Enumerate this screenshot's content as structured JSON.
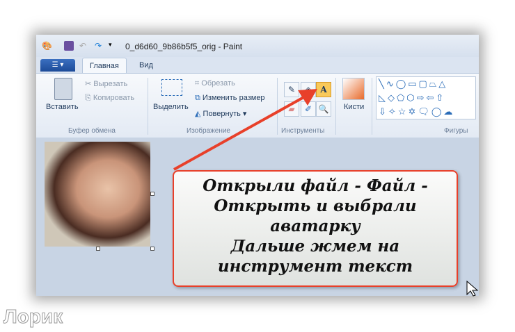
{
  "window": {
    "title": "0_d6d60_9b86b5f5_orig - Paint"
  },
  "tabs": [
    {
      "label": "Главная",
      "active": true
    },
    {
      "label": "Вид",
      "active": false
    }
  ],
  "clipboard": {
    "paste": "Вставить",
    "cut": "Вырезать",
    "copy": "Копировать",
    "group": "Буфер обмена"
  },
  "image": {
    "select": "Выделить",
    "crop": "Обрезать",
    "resize": "Изменить размер",
    "rotate": "Повернуть",
    "group": "Изображение"
  },
  "tools": {
    "group": "Инструменты",
    "icons": [
      "pencil-icon",
      "fill-icon",
      "text-icon",
      "eraser-icon",
      "color-picker-icon",
      "magnifier-icon"
    ],
    "text_glyph": "A"
  },
  "brushes": {
    "label": "Кисти"
  },
  "shapes": {
    "group": "Фигуры",
    "row1": "╲∿◯▭▢⏢△",
    "row2": "◺◇⬠⬡⇨⇦⇧",
    "row3": "⇩✧☆✡🗨◯☁"
  },
  "callout": {
    "lines": [
      "Открыли файл - Файл -",
      "Открыть и выбрали",
      "аватарку",
      "Дальше жмем на",
      "инструмент текст"
    ],
    "border_color": "#e8402a"
  },
  "watermark": "Лорик"
}
